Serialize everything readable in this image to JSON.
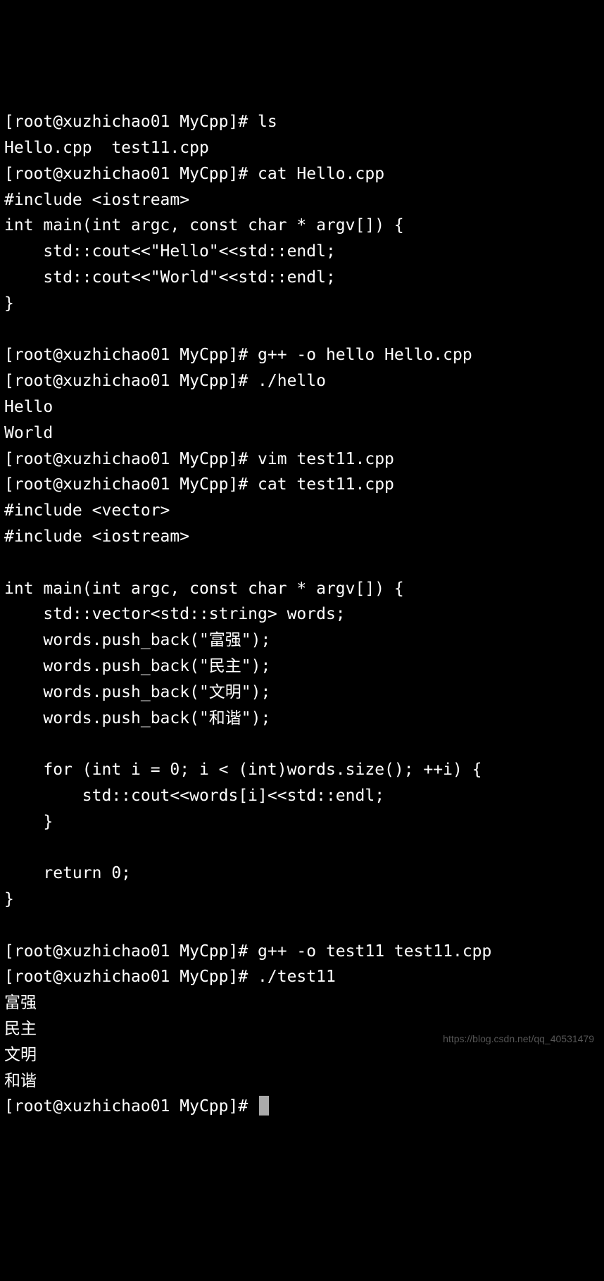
{
  "prompt": "[root@xuzhichao01 MyCpp]# ",
  "lines": [
    {
      "t": "prompt",
      "cmd": "ls"
    },
    {
      "t": "out",
      "text": "Hello.cpp  test11.cpp"
    },
    {
      "t": "prompt",
      "cmd": "cat Hello.cpp"
    },
    {
      "t": "out",
      "text": "#include <iostream>"
    },
    {
      "t": "out",
      "text": "int main(int argc, const char * argv[]) {"
    },
    {
      "t": "out",
      "text": "    std::cout<<\"Hello\"<<std::endl;"
    },
    {
      "t": "out",
      "text": "    std::cout<<\"World\"<<std::endl;"
    },
    {
      "t": "out",
      "text": "}"
    },
    {
      "t": "out",
      "text": ""
    },
    {
      "t": "prompt",
      "cmd": "g++ -o hello Hello.cpp"
    },
    {
      "t": "prompt",
      "cmd": "./hello"
    },
    {
      "t": "out",
      "text": "Hello"
    },
    {
      "t": "out",
      "text": "World"
    },
    {
      "t": "prompt",
      "cmd": "vim test11.cpp"
    },
    {
      "t": "prompt",
      "cmd": "cat test11.cpp"
    },
    {
      "t": "out",
      "text": "#include <vector>"
    },
    {
      "t": "out",
      "text": "#include <iostream>"
    },
    {
      "t": "out",
      "text": ""
    },
    {
      "t": "out",
      "text": "int main(int argc, const char * argv[]) {"
    },
    {
      "t": "out",
      "text": "    std::vector<std::string> words;"
    },
    {
      "t": "out",
      "text": "    words.push_back(\"富强\");"
    },
    {
      "t": "out",
      "text": "    words.push_back(\"民主\");"
    },
    {
      "t": "out",
      "text": "    words.push_back(\"文明\");"
    },
    {
      "t": "out",
      "text": "    words.push_back(\"和谐\");"
    },
    {
      "t": "out",
      "text": ""
    },
    {
      "t": "out",
      "text": "    for (int i = 0; i < (int)words.size(); ++i) {"
    },
    {
      "t": "out",
      "text": "        std::cout<<words[i]<<std::endl;"
    },
    {
      "t": "out",
      "text": "    }"
    },
    {
      "t": "out",
      "text": ""
    },
    {
      "t": "out",
      "text": "    return 0;"
    },
    {
      "t": "out",
      "text": "}"
    },
    {
      "t": "out",
      "text": ""
    },
    {
      "t": "prompt",
      "cmd": "g++ -o test11 test11.cpp"
    },
    {
      "t": "prompt",
      "cmd": "./test11"
    },
    {
      "t": "out",
      "text": "富强"
    },
    {
      "t": "out",
      "text": "民主"
    },
    {
      "t": "out",
      "text": "文明"
    },
    {
      "t": "out",
      "text": "和谐"
    },
    {
      "t": "prompt",
      "cmd": "",
      "cursor": true
    }
  ],
  "watermark": "https://blog.csdn.net/qq_40531479"
}
